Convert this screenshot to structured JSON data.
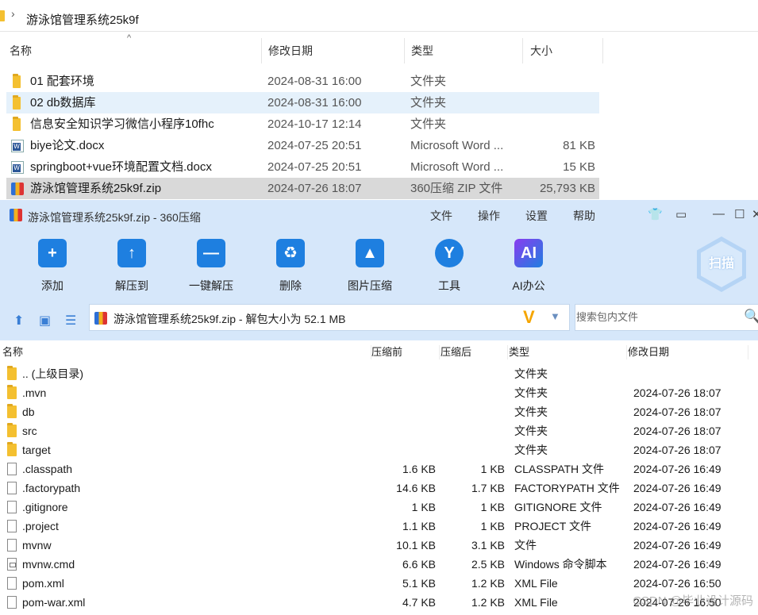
{
  "explorer": {
    "path": "游泳馆管理系统25k9f",
    "columns": {
      "name": "名称",
      "date": "修改日期",
      "type": "类型",
      "size": "大小"
    },
    "rows": [
      {
        "name": "01 配套环境",
        "date": "2024-08-31 16:00",
        "type": "文件夹",
        "size": "",
        "icon": "folder-icon"
      },
      {
        "name": "02 db数据库",
        "date": "2024-08-31 16:00",
        "type": "文件夹",
        "size": "",
        "icon": "folder-icon"
      },
      {
        "name": "信息安全知识学习微信小程序10fhc",
        "date": "2024-10-17 12:14",
        "type": "文件夹",
        "size": "",
        "icon": "folder-icon"
      },
      {
        "name": "biye论文.docx",
        "date": "2024-07-25 20:51",
        "type": "Microsoft Word ...",
        "size": "81 KB",
        "icon": "word-doc-icon"
      },
      {
        "name": "springboot+vue环境配置文档.docx",
        "date": "2024-07-25 20:51",
        "type": "Microsoft Word ...",
        "size": "15 KB",
        "icon": "word-doc-icon"
      },
      {
        "name": "游泳馆管理系统25k9f.zip",
        "date": "2024-07-26 18:07",
        "type": "360压缩 ZIP 文件",
        "size": "25,793 KB",
        "icon": "zip-archive-icon"
      }
    ]
  },
  "zip": {
    "title": "游泳馆管理系统25k9f.zip - 360压缩",
    "menu": [
      "文件",
      "操作",
      "设置",
      "帮助"
    ],
    "toolbar": [
      {
        "label": "添加",
        "icon": "add-icon"
      },
      {
        "label": "解压到",
        "icon": "extract-to-icon"
      },
      {
        "label": "一键解压",
        "icon": "one-click-extract-icon"
      },
      {
        "label": "删除",
        "icon": "delete-icon"
      },
      {
        "label": "图片压缩",
        "icon": "image-compress-icon"
      },
      {
        "label": "工具",
        "icon": "tools-icon"
      },
      {
        "label": "AI办公",
        "icon": "ai-icon"
      }
    ],
    "scan_label": "扫描",
    "path_text": "游泳馆管理系统25k9f.zip - 解包大小为 52.1 MB",
    "search_placeholder": "搜索包内文件",
    "columns": {
      "name": "名称",
      "before": "压缩前",
      "after": "压缩后",
      "type": "类型",
      "modified": "修改日期"
    },
    "rows": [
      {
        "name": ".. (上级目录)",
        "before": "",
        "after": "",
        "type": "文件夹",
        "modified": "",
        "icon": "folder-icon"
      },
      {
        "name": ".mvn",
        "before": "",
        "after": "",
        "type": "文件夹",
        "modified": "2024-07-26 18:07",
        "icon": "folder-icon"
      },
      {
        "name": "db",
        "before": "",
        "after": "",
        "type": "文件夹",
        "modified": "2024-07-26 18:07",
        "icon": "folder-icon"
      },
      {
        "name": "src",
        "before": "",
        "after": "",
        "type": "文件夹",
        "modified": "2024-07-26 18:07",
        "icon": "folder-icon"
      },
      {
        "name": "target",
        "before": "",
        "after": "",
        "type": "文件夹",
        "modified": "2024-07-26 18:07",
        "icon": "folder-icon"
      },
      {
        "name": ".classpath",
        "before": "1.6 KB",
        "after": "1 KB",
        "type": "CLASSPATH 文件",
        "modified": "2024-07-26 16:49",
        "icon": "file-icon"
      },
      {
        "name": ".factorypath",
        "before": "14.6 KB",
        "after": "1.7 KB",
        "type": "FACTORYPATH 文件",
        "modified": "2024-07-26 16:49",
        "icon": "file-icon"
      },
      {
        "name": ".gitignore",
        "before": "1 KB",
        "after": "1 KB",
        "type": "GITIGNORE 文件",
        "modified": "2024-07-26 16:49",
        "icon": "file-icon"
      },
      {
        "name": ".project",
        "before": "1.1 KB",
        "after": "1 KB",
        "type": "PROJECT 文件",
        "modified": "2024-07-26 16:49",
        "icon": "file-icon"
      },
      {
        "name": "mvnw",
        "before": "10.1 KB",
        "after": "3.1 KB",
        "type": "文件",
        "modified": "2024-07-26 16:49",
        "icon": "file-icon"
      },
      {
        "name": "mvnw.cmd",
        "before": "6.6 KB",
        "after": "2.5 KB",
        "type": "Windows 命令脚本",
        "modified": "2024-07-26 16:49",
        "icon": "cmd-script-icon"
      },
      {
        "name": "pom.xml",
        "before": "5.1 KB",
        "after": "1.2 KB",
        "type": "XML File",
        "modified": "2024-07-26 16:50",
        "icon": "file-icon"
      },
      {
        "name": "pom-war.xml",
        "before": "4.7 KB",
        "after": "1.2 KB",
        "type": "XML File",
        "modified": "2024-07-26 16:50",
        "icon": "file-icon"
      }
    ]
  },
  "watermark": "CSDN @毕业设计源码"
}
